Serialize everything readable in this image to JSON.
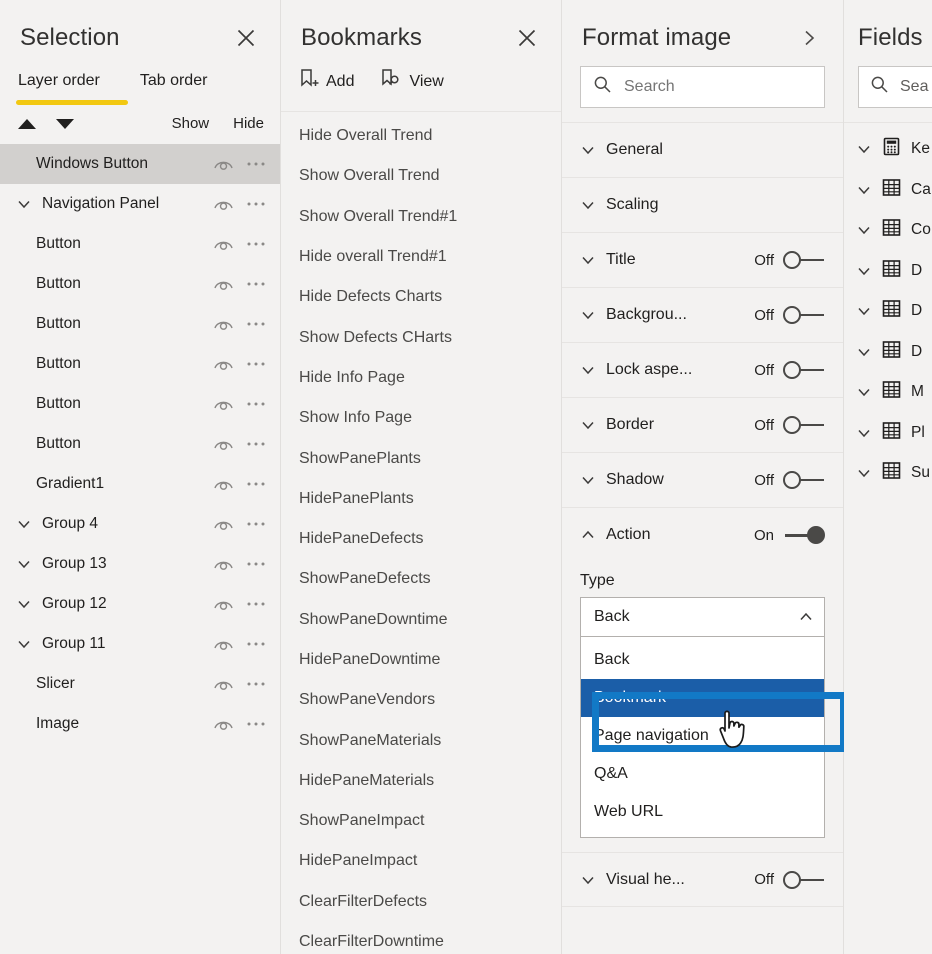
{
  "selection": {
    "title": "Selection",
    "close_icon": "close-icon",
    "tabs": [
      {
        "label": "Layer order",
        "active": true
      },
      {
        "label": "Tab order",
        "active": false
      }
    ],
    "accent_color": "#f2c811",
    "toolbar": {
      "move_up_icon": "triangle-up-icon",
      "move_down_icon": "triangle-down-icon",
      "show_label": "Show",
      "hide_label": "Hide"
    },
    "layers": [
      {
        "name": "Windows Button",
        "caret": false,
        "indent": false,
        "selected": true
      },
      {
        "name": "Navigation Panel",
        "caret": true,
        "indent": true,
        "selected": false
      },
      {
        "name": "Button",
        "caret": false,
        "indent": false,
        "selected": false
      },
      {
        "name": "Button",
        "caret": false,
        "indent": false,
        "selected": false
      },
      {
        "name": "Button",
        "caret": false,
        "indent": false,
        "selected": false
      },
      {
        "name": "Button",
        "caret": false,
        "indent": false,
        "selected": false
      },
      {
        "name": "Button",
        "caret": false,
        "indent": false,
        "selected": false
      },
      {
        "name": "Button",
        "caret": false,
        "indent": false,
        "selected": false
      },
      {
        "name": "Gradient1",
        "caret": false,
        "indent": false,
        "selected": false
      },
      {
        "name": "Group 4",
        "caret": true,
        "indent": true,
        "selected": false
      },
      {
        "name": "Group 13",
        "caret": true,
        "indent": true,
        "selected": false
      },
      {
        "name": "Group 12",
        "caret": true,
        "indent": true,
        "selected": false
      },
      {
        "name": "Group 11",
        "caret": true,
        "indent": true,
        "selected": false
      },
      {
        "name": "Slicer",
        "caret": false,
        "indent": false,
        "selected": false
      },
      {
        "name": "Image",
        "caret": false,
        "indent": false,
        "selected": false
      }
    ]
  },
  "bookmarks": {
    "title": "Bookmarks",
    "close_icon": "close-icon",
    "tools": [
      {
        "label": "Add",
        "icon": "bookmark-add-icon"
      },
      {
        "label": "View",
        "icon": "bookmark-view-icon"
      }
    ],
    "items": [
      "Hide Overall Trend",
      "Show Overall Trend",
      "Show Overall Trend#1",
      "Hide overall Trend#1",
      "Hide Defects Charts",
      "Show Defects CHarts",
      "Hide Info Page",
      "Show Info Page",
      "ShowPanePlants",
      "HidePanePlants",
      "HidePaneDefects",
      "ShowPaneDefects",
      "ShowPaneDowntime",
      "HidePaneDowntime",
      "ShowPaneVendors",
      "ShowPaneMaterials",
      "HidePaneMaterials",
      "ShowPaneImpact",
      "HidePaneImpact",
      "ClearFilterDefects",
      "ClearFilterDowntime"
    ]
  },
  "format": {
    "title": "Format image",
    "expand_icon": "chevron-right-icon",
    "search_placeholder": "Search",
    "search_icon": "search-icon",
    "sections": [
      {
        "label": "General",
        "expanded": false,
        "has_toggle": false
      },
      {
        "label": "Scaling",
        "expanded": false,
        "has_toggle": false
      },
      {
        "label": "Title",
        "expanded": false,
        "has_toggle": true,
        "state": "Off",
        "on": false
      },
      {
        "label": "Backgrou...",
        "expanded": false,
        "has_toggle": true,
        "state": "Off",
        "on": false
      },
      {
        "label": "Lock aspe...",
        "expanded": false,
        "has_toggle": true,
        "state": "Off",
        "on": false
      },
      {
        "label": "Border",
        "expanded": false,
        "has_toggle": true,
        "state": "Off",
        "on": false
      },
      {
        "label": "Shadow",
        "expanded": false,
        "has_toggle": true,
        "state": "Off",
        "on": false
      },
      {
        "label": "Action",
        "expanded": true,
        "has_toggle": true,
        "state": "On",
        "on": true
      }
    ],
    "action": {
      "type_label": "Type",
      "selected_value": "Back",
      "dropdown_open": true,
      "options": [
        "Back",
        "Bookmark",
        "Page navigation",
        "Q&A",
        "Web URL"
      ],
      "highlighted_option": "Bookmark"
    },
    "footer_section": {
      "label": "Visual he...",
      "state": "Off",
      "on": false
    },
    "annotation_color": "#1279c6",
    "highlight_color": "#1b5ea8"
  },
  "fields": {
    "title": "Fields",
    "search_placeholder": "Sea",
    "search_icon": "search-icon",
    "items": [
      {
        "name": "Ke",
        "icon": "measure-calculator-icon"
      },
      {
        "name": "Ca",
        "icon": "table-icon"
      },
      {
        "name": "Co",
        "icon": "table-icon"
      },
      {
        "name": "D",
        "icon": "table-icon"
      },
      {
        "name": "D",
        "icon": "table-icon"
      },
      {
        "name": "D",
        "icon": "table-icon"
      },
      {
        "name": "M",
        "icon": "table-icon"
      },
      {
        "name": "Pl",
        "icon": "table-icon"
      },
      {
        "name": "Su",
        "icon": "table-icon"
      }
    ]
  }
}
